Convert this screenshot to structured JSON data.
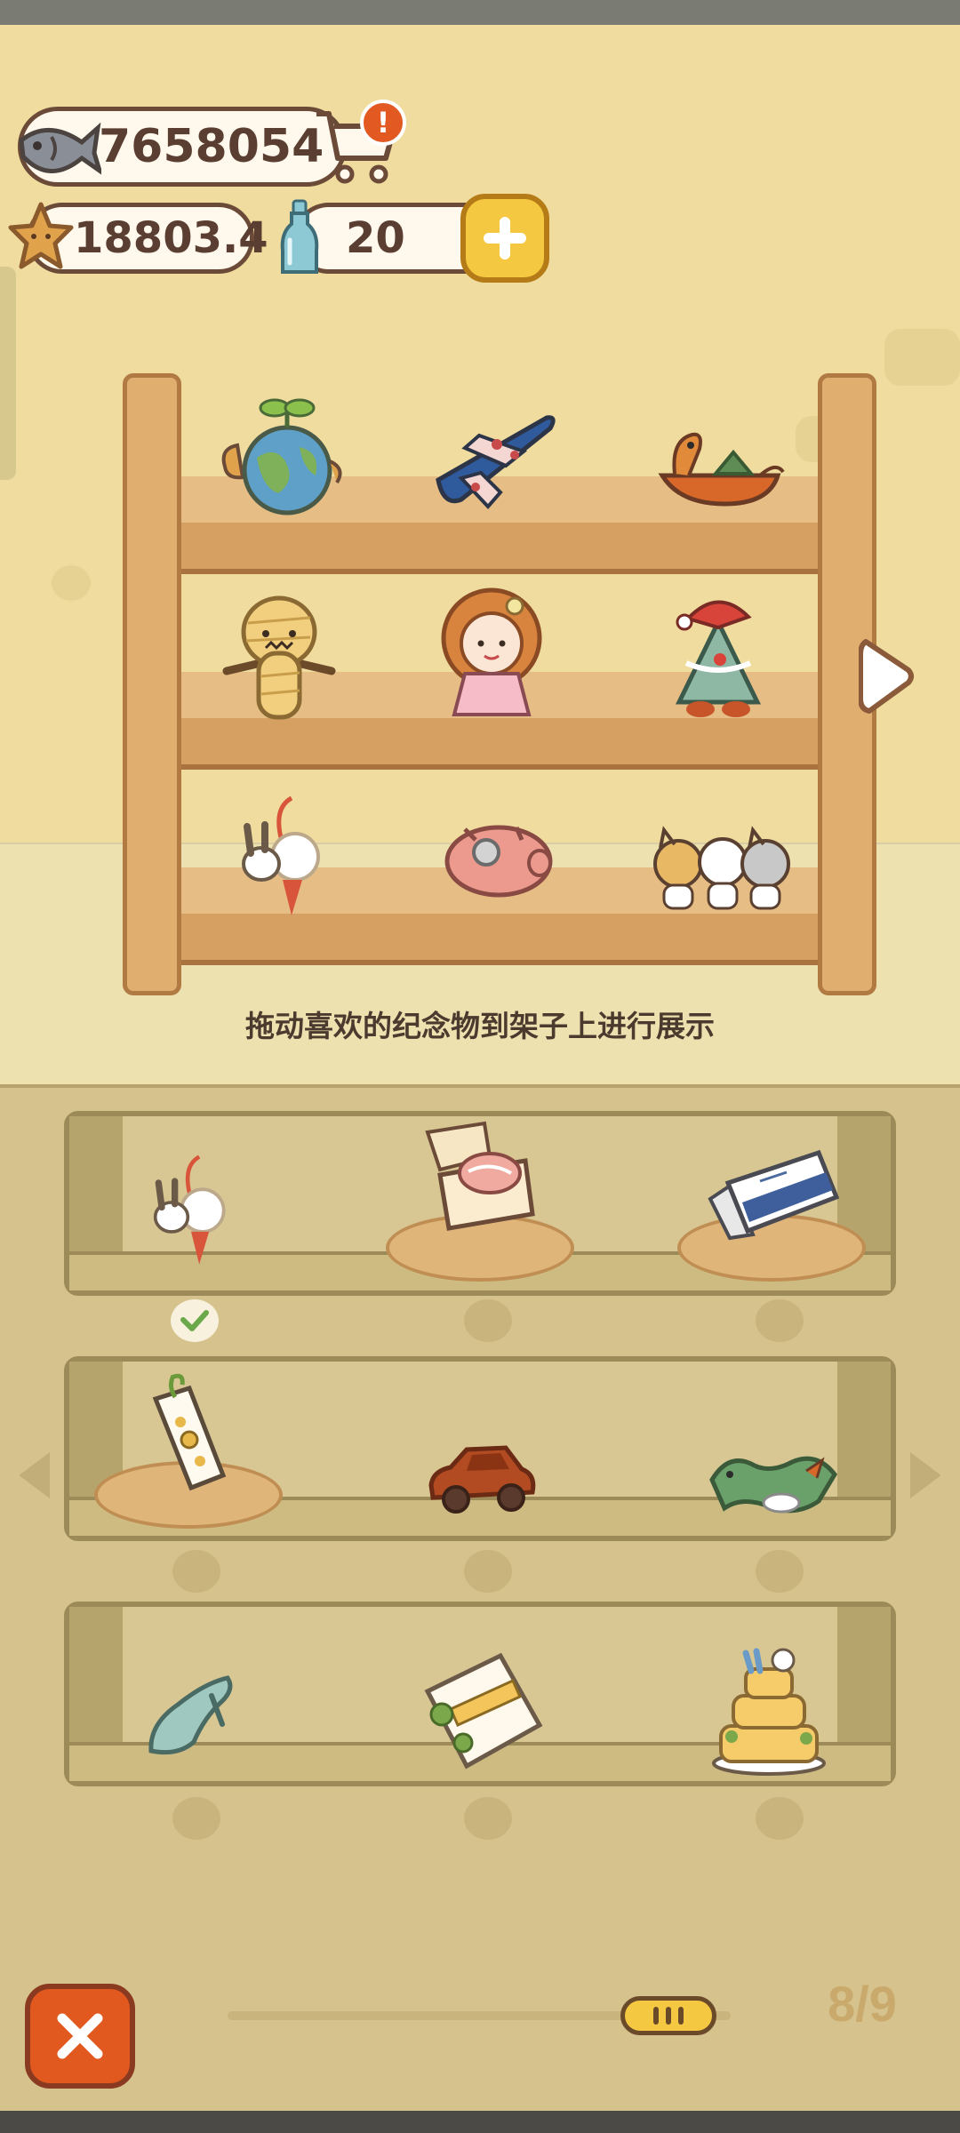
{
  "currency": {
    "fish_amount": "7658054",
    "star_amount": "18803.4",
    "bottle_amount": "20",
    "shop_alert": "!"
  },
  "display_shelf": {
    "instruction": "拖动喜欢的纪念物到架子上进行展示",
    "items": [
      [
        "earth-sprout-souvenir-icon",
        "plane-souvenir-icon",
        "dragon-boat-souvenir-icon"
      ],
      [
        "voodoo-doll-souvenir-icon",
        "curly-girl-doll-souvenir-icon",
        "christmas-tree-souvenir-icon"
      ],
      [
        "rabbit-charm-souvenir-icon",
        "piggy-bank-souvenir-icon",
        "cat-friends-souvenir-icon"
      ]
    ]
  },
  "inventory": {
    "rows": [
      [
        "rabbit-charm-souvenir-icon",
        "salmon-box-souvenir-icon",
        "ticket-card-souvenir-icon"
      ],
      [
        "flower-bookmark-souvenir-icon",
        "toy-car-souvenir-icon",
        "dragon-souvenir-icon"
      ],
      [
        "glass-slipper-souvenir-icon",
        "bento-gift-souvenir-icon",
        "layer-cake-souvenir-icon"
      ]
    ],
    "placed_index": 0
  },
  "pager": {
    "page_text": "8/9",
    "current_page": 8,
    "total_pages": 9
  },
  "colors": {
    "wall": "#efdc9e",
    "panel": "#d6c28c",
    "close_button": "#e1591e",
    "plus_button": "#f5c842",
    "alert": "#e25a22"
  }
}
